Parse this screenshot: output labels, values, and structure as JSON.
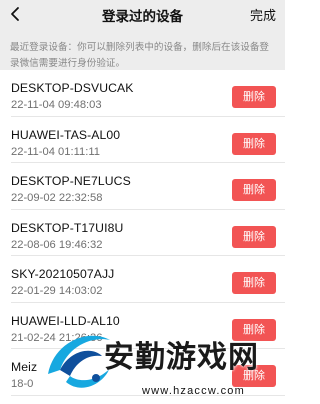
{
  "header": {
    "title": "登录过的设备",
    "done_label": "完成"
  },
  "notice": "最近登录设备：你可以删除列表中的设备，删除后在该设备登录微信需要进行身份验证。",
  "devices": [
    {
      "name": "DESKTOP-DSVUCAK",
      "time": "22-11-04 09:48:03",
      "delete_label": "删除"
    },
    {
      "name": "HUAWEI-TAS-AL00",
      "time": "22-11-04 01:11:11",
      "delete_label": "删除"
    },
    {
      "name": "DESKTOP-NE7LUCS",
      "time": "22-09-02 22:32:58",
      "delete_label": "删除"
    },
    {
      "name": "DESKTOP-T17UI8U",
      "time": "22-08-06 19:46:32",
      "delete_label": "删除"
    },
    {
      "name": "SKY-20210507AJJ",
      "time": "22-01-29 14:03:02",
      "delete_label": "删除"
    },
    {
      "name": "HUAWEI-LLD-AL10",
      "time": "21-02-24 21:26:36",
      "delete_label": "删除"
    },
    {
      "name": "Meiz",
      "time": "18-0",
      "delete_label": "删除"
    }
  ],
  "watermark": {
    "text": "安勤游戏网",
    "url": "www.hzaccw.com"
  },
  "colors": {
    "delete_button": "#f25454",
    "header_bg": "#ededed"
  }
}
